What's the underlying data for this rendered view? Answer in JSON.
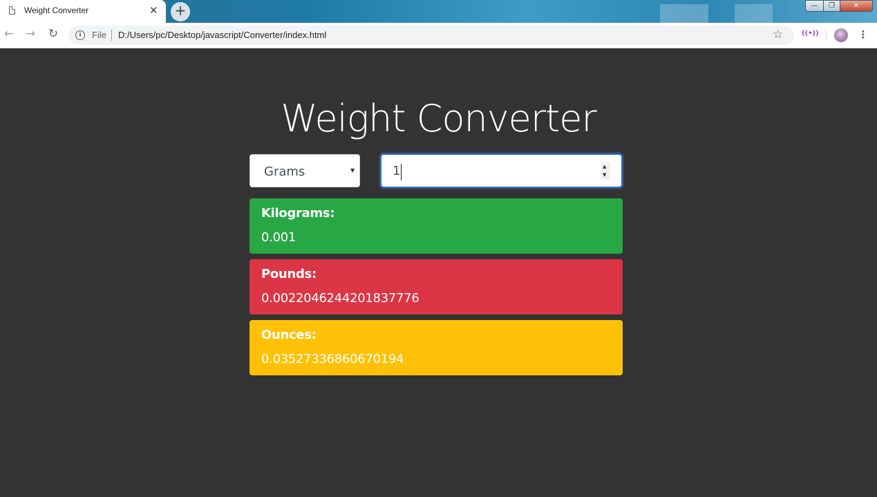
{
  "browser": {
    "tab_title": "Weight Converter",
    "tab_close": "✕",
    "new_tab": "+",
    "omnibox_file_label": "File",
    "url": "D:/Users/pc/Desktop/javascript/Converter/index.html",
    "window_controls": {
      "minimize": "—",
      "maximize": "❐",
      "close": "✕"
    }
  },
  "page": {
    "heading": "Weight Converter",
    "unit_select": {
      "selected": "Grams"
    },
    "amount_input": {
      "value": "1"
    },
    "results": [
      {
        "label": "Kilograms:",
        "value": "0.001",
        "color": "#28a745"
      },
      {
        "label": "Pounds:",
        "value": "0.0022046244201837776",
        "color": "#dc3545"
      },
      {
        "label": "Ounces:",
        "value": "0.03527336860670194",
        "color": "#ffc107"
      }
    ]
  },
  "icons": {
    "page_icon": "document-icon",
    "back": "arrow-left-icon",
    "forward": "arrow-right-icon",
    "reload": "reload-icon",
    "info": "info-icon",
    "star": "star-icon",
    "cast": "cast-icon",
    "profile": "avatar",
    "menu": "kebab-menu-icon"
  }
}
